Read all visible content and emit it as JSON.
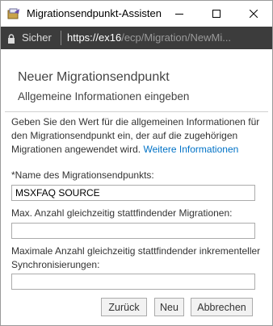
{
  "window": {
    "title": "Migrationsendpunkt-Assisten",
    "controls": {
      "minimize": "–",
      "maximize": "☐",
      "close": "✕"
    }
  },
  "address_bar": {
    "secure_label": "Sicher",
    "url_host": "https://ex16",
    "url_path": "/ecp/Migration/NewMi..."
  },
  "wizard": {
    "heading": "Neuer Migrationsendpunkt",
    "subheading": "Allgemeine Informationen eingeben",
    "description": "Geben Sie den Wert für die allgemeinen Informationen für den Migrationsendpunkt ein, der auf die zugehörigen Migrationen angewendet wird.",
    "more_info_link": "Weitere Informationen",
    "fields": [
      {
        "label": "*Name des Migrationsendpunkts:",
        "value": "MSXFAQ SOURCE"
      },
      {
        "label": "Max. Anzahl gleichzeitig stattfindender Migrationen:",
        "value": ""
      },
      {
        "label": "Maximale Anzahl gleichzeitig stattfindender inkrementeller Synchronisierungen:",
        "value": ""
      }
    ],
    "buttons": {
      "back": "Zurück",
      "next": "Neu",
      "cancel": "Abbrechen"
    }
  },
  "colors": {
    "link": "#0072c6",
    "address_bar_bg": "#3c3c3c",
    "button_bg": "#f2f2f2"
  }
}
